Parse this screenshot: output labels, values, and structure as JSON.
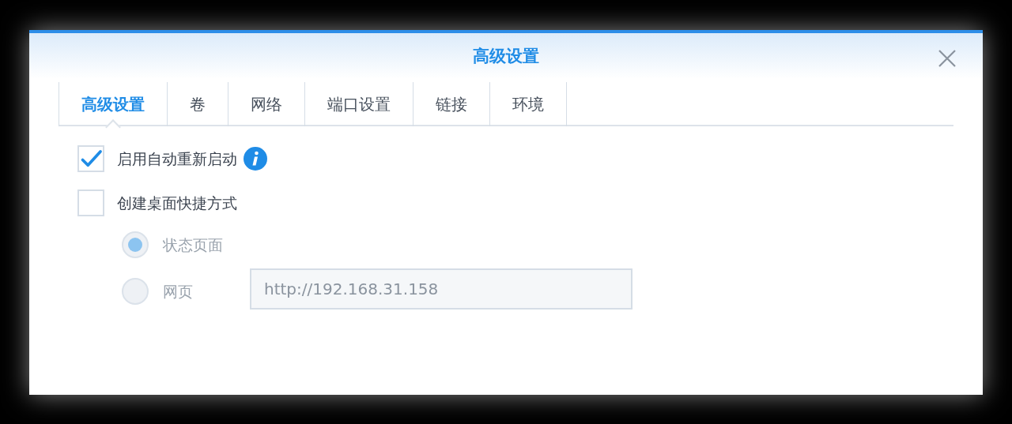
{
  "dialog": {
    "title": "高级设置"
  },
  "tabs": [
    {
      "label": "高级设置",
      "selected": true
    },
    {
      "label": "卷",
      "selected": false
    },
    {
      "label": "网络",
      "selected": false
    },
    {
      "label": "端口设置",
      "selected": false
    },
    {
      "label": "链接",
      "selected": false
    },
    {
      "label": "环境",
      "selected": false
    }
  ],
  "options": [
    {
      "kind": "checkbox",
      "label": "启用自动重新启动",
      "checked": true,
      "info": true
    },
    {
      "kind": "checkbox",
      "label": "创建桌面快捷方式",
      "checked": false
    }
  ],
  "shortcut_targets": [
    {
      "label": "状态页面",
      "selected": true,
      "disabled": true
    },
    {
      "label": "网页",
      "selected": false,
      "disabled": true,
      "field": {
        "value": "http://192.168.31.158"
      }
    }
  ]
}
